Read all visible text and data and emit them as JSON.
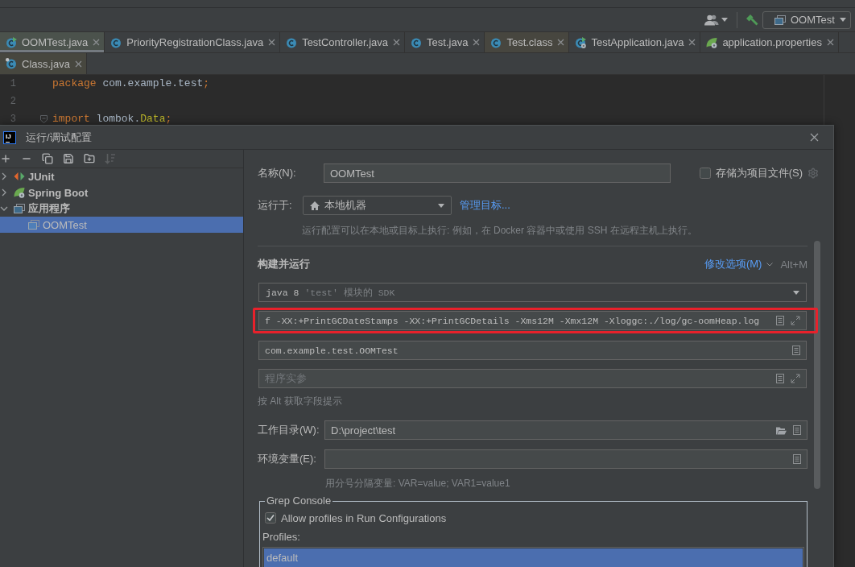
{
  "toolbar": {
    "run_configuration": "OOMTest"
  },
  "editor_tab_rows": [
    {
      "tabs": [
        {
          "label": "OOMTest.java",
          "kind": "runnable-class",
          "selected": true,
          "color": "#4b524c"
        },
        {
          "label": "PriorityRegistrationClass.java",
          "kind": "class",
          "selected": false,
          "color": "#3c3f41"
        },
        {
          "label": "TestController.java",
          "kind": "class",
          "selected": false,
          "color": "#3c3f41"
        },
        {
          "label": "Test.java",
          "kind": "class",
          "selected": false,
          "color": "#3c3f41"
        },
        {
          "label": "Test.class",
          "kind": "class",
          "selected": false,
          "color": "#47463f"
        },
        {
          "label": "TestApplication.java",
          "kind": "runnable-spring-class",
          "selected": false,
          "color": "#3c3f41"
        },
        {
          "label": "application.properties",
          "kind": "spring-properties",
          "selected": false,
          "color": "#3c3f41"
        }
      ]
    },
    {
      "tabs": [
        {
          "label": "Class.java",
          "kind": "library-class",
          "selected": false,
          "color": "#47473f"
        }
      ]
    }
  ],
  "editor": {
    "lines": [
      {
        "number": "1",
        "foldable": false,
        "tokens": [
          {
            "text": "package",
            "kind": "keyword"
          },
          {
            "text": " com.example.test",
            "kind": "plain"
          },
          {
            "text": ";",
            "kind": "keyword"
          }
        ]
      },
      {
        "number": "2",
        "foldable": false
      },
      {
        "number": "3",
        "foldable": true,
        "tokens": [
          {
            "text": "import",
            "kind": "keyword"
          },
          {
            "text": " lombok.",
            "kind": "plain"
          },
          {
            "text": "Data",
            "kind": "annotation"
          },
          {
            "text": ";",
            "kind": "keyword"
          }
        ]
      }
    ]
  },
  "dialog": {
    "logo": "IJ",
    "title": "运行/调试配置",
    "toolbar": [
      {
        "kind": "add",
        "disabled": false
      },
      {
        "kind": "remove",
        "disabled": false
      },
      {
        "kind": "copy",
        "disabled": false
      },
      {
        "kind": "save",
        "disabled": false
      },
      {
        "kind": "new-folder",
        "disabled": false
      },
      {
        "kind": "sort",
        "disabled": true
      }
    ],
    "tree": [
      {
        "label": "JUnit",
        "kind": "junit",
        "expanded": false,
        "selected": false
      },
      {
        "label": "Spring Boot",
        "kind": "spring-boot",
        "expanded": false,
        "selected": false
      },
      {
        "label": "应用程序",
        "kind": "application",
        "expanded": true,
        "selected": false,
        "children": [
          {
            "label": "OOMTest",
            "kind": "application",
            "selected": true
          }
        ]
      }
    ],
    "form": {
      "name": {
        "label": "名称(N):",
        "value": "OOMTest"
      },
      "store_as_project_file": {
        "label": "存储为项目文件(S)",
        "checked": false
      },
      "run_on": {
        "label": "运行于:",
        "value": "本地机器",
        "link": "管理目标..."
      },
      "run_on_hint": "运行配置可以在本地或目标上执行: 例如，在 Docker 容器中或使用 SSH 在远程主机上执行。",
      "section": {
        "title": "构建并运行",
        "modify_options": "修改选项(M)",
        "shortcut": "Alt+M"
      },
      "sdk": {
        "value": "java 8",
        "detail": "'test' 模块的 SDK"
      },
      "vm_options": {
        "value": "f -XX:+PrintGCDateStamps -XX:+PrintGCDetails -Xms12M -Xmx12M -Xloggc:./log/gc-oomHeap.log",
        "highlighted": true
      },
      "main_class": {
        "value": "com.example.test.OOMTest"
      },
      "program_arguments": {
        "placeholder": "程序实参"
      },
      "field_hint": "按 Alt 获取字段提示",
      "working_directory": {
        "label": "工作目录(W):",
        "value": "D:\\project\\test"
      },
      "environment_variables": {
        "label": "环境变量(E):"
      },
      "environment_hint": "用分号分隔变量: VAR=value; VAR1=value1",
      "grep_console": {
        "title": "Grep Console",
        "allow_profiles": {
          "label": "Allow profiles in Run Configurations",
          "checked": true
        },
        "profiles_label": "Profiles:",
        "profiles": [
          {
            "label": "default",
            "selected": true
          }
        ]
      }
    }
  }
}
